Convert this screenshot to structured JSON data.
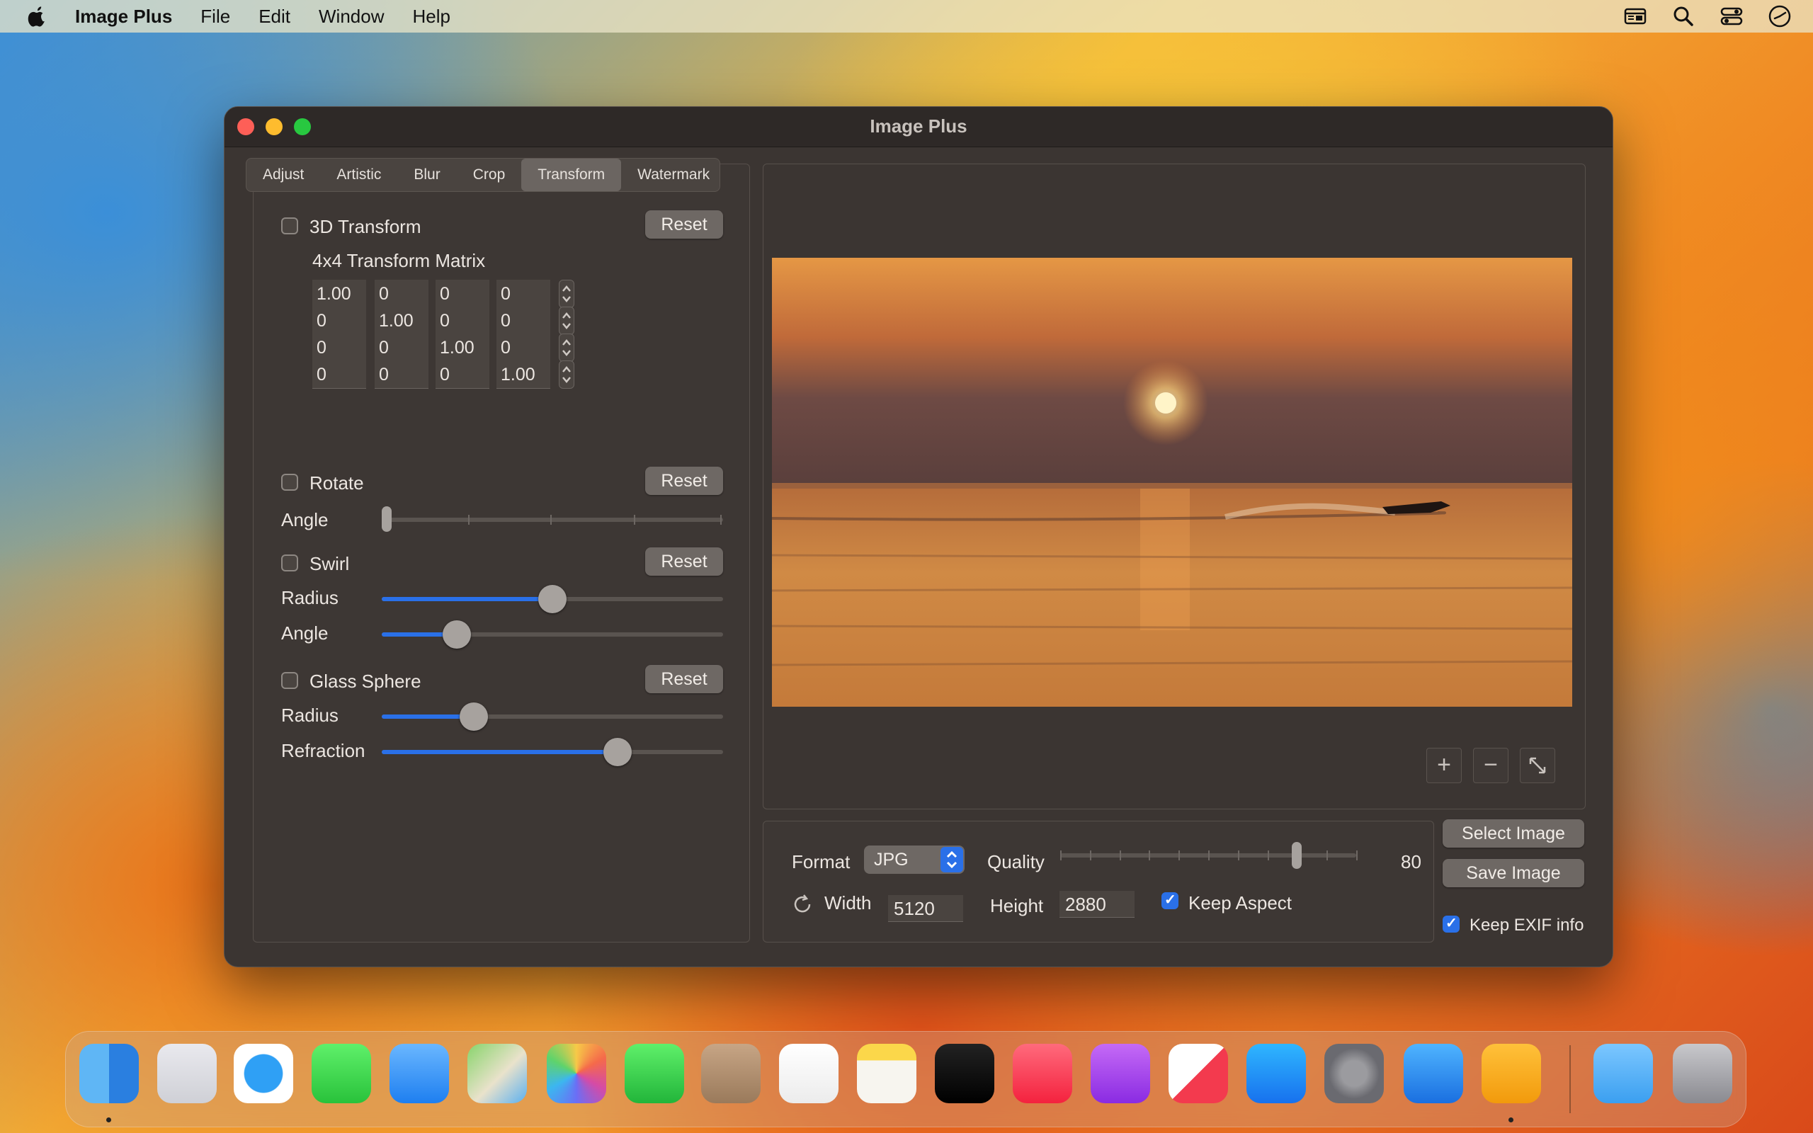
{
  "menubar": {
    "app_name": "Image Plus",
    "items": [
      "File",
      "Edit",
      "Window",
      "Help"
    ]
  },
  "window": {
    "title": "Image Plus"
  },
  "tabs": [
    {
      "label": "Adjust"
    },
    {
      "label": "Artistic"
    },
    {
      "label": "Blur"
    },
    {
      "label": "Crop"
    },
    {
      "label": "Transform",
      "active": true
    },
    {
      "label": "Watermark"
    }
  ],
  "transform3d": {
    "label": "3D Transform",
    "checked": false,
    "reset_label": "Reset",
    "matrix_label": "4x4 Transform Matrix",
    "matrix": [
      [
        "1.00",
        "0",
        "0",
        "0"
      ],
      [
        "0",
        "1.00",
        "0",
        "0"
      ],
      [
        "0",
        "0",
        "1.00",
        "0"
      ],
      [
        "0",
        "0",
        "0",
        "1.00"
      ]
    ]
  },
  "rotate": {
    "label": "Rotate",
    "checked": false,
    "reset_label": "Reset",
    "angle_label": "Angle",
    "angle_fraction": 0.0
  },
  "swirl": {
    "label": "Swirl",
    "checked": false,
    "reset_label": "Reset",
    "radius_label": "Radius",
    "radius_fraction": 0.5,
    "angle_label": "Angle",
    "angle_fraction": 0.22
  },
  "glass_sphere": {
    "label": "Glass Sphere",
    "checked": false,
    "reset_label": "Reset",
    "radius_label": "Radius",
    "radius_fraction": 0.27,
    "refraction_label": "Refraction",
    "refraction_fraction": 0.69
  },
  "preview": {
    "zoom_in": "+",
    "zoom_out": "−"
  },
  "export": {
    "format_label": "Format",
    "format_value": "JPG",
    "quality_label": "Quality",
    "quality_value": "80",
    "quality_fraction": 0.8,
    "width_label": "Width",
    "width_value": "5120",
    "height_label": "Height",
    "height_value": "2880",
    "keep_aspect_label": "Keep Aspect",
    "keep_aspect": true
  },
  "actions": {
    "select_image": "Select Image",
    "save_image": "Save Image",
    "keep_exif_label": "Keep EXIF info",
    "keep_exif": true
  },
  "colors": {
    "accent": "#2a70e8",
    "window_bg": "#3b3532",
    "button_bg": "#6e6864"
  },
  "dock": {
    "apps": [
      "finder-icon",
      "launchpad-icon",
      "safari-icon",
      "messages-icon",
      "mail-icon",
      "maps-icon",
      "photos-icon",
      "facetime-icon",
      "contacts-icon",
      "reminders-icon",
      "notes-icon",
      "apple-tv-icon",
      "music-icon",
      "podcasts-icon",
      "news-icon",
      "app-store-icon",
      "system-settings-icon",
      "image-plus-icon",
      "crop-app-icon",
      "downloads-folder-icon",
      "trash-icon"
    ]
  }
}
